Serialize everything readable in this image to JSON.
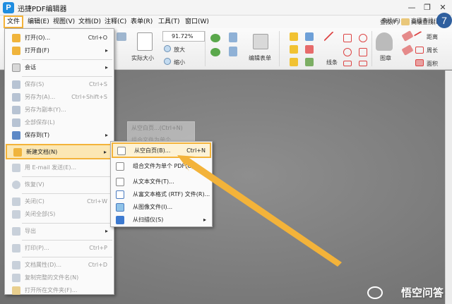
{
  "app": {
    "logo": "P",
    "title": "迅捷PDF编辑器"
  },
  "window_controls": {
    "minimize": "—",
    "restore": "❐",
    "close": "✕"
  },
  "menubar": [
    "文件",
    "编辑(E)",
    "视图(V)",
    "文档(D)",
    "注释(C)",
    "表单(R)",
    "工具(T)",
    "窗口(W)"
  ],
  "ribbon": {
    "actual_size": "实际大小",
    "zoom_value": "91.72%",
    "zoom_in": "放大",
    "zoom_out": "缩小",
    "edit_form": "编辑表单",
    "lines": "线条",
    "stamp": "图章",
    "find": "查找(F)",
    "advanced_find": "高级查找(H",
    "distance": "距离",
    "perimeter": "周长",
    "area": "面积"
  },
  "badge": "7",
  "file_menu": {
    "items": [
      {
        "label": "打开(O)...",
        "shortcut": "Ctrl+O",
        "disabled": false,
        "icon": "folder-icon"
      },
      {
        "label": "打开自(F)",
        "arrow": "▸",
        "disabled": false,
        "icon": "folder-icon"
      },
      {
        "label": "会话",
        "arrow": "▸",
        "disabled": false,
        "icon": "session-icon"
      },
      {
        "label": "保存(S)",
        "shortcut": "Ctrl+S",
        "disabled": true,
        "icon": "save-icon"
      },
      {
        "label": "另存为(A)...",
        "shortcut": "Ctrl+Shift+S",
        "disabled": true,
        "icon": "save-as-icon"
      },
      {
        "label": "另存为副本(Y)...",
        "disabled": true,
        "icon": "save-copy-icon"
      },
      {
        "label": "全部保存(L)",
        "disabled": true,
        "icon": "save-all-icon"
      },
      {
        "label": "保存到(T)",
        "arrow": "▸",
        "disabled": false,
        "icon": "save-to-icon"
      },
      {
        "label": "新建文档(N)",
        "arrow": "▸",
        "disabled": false,
        "icon": "new-document-icon"
      },
      {
        "label": "用 E-mail 发送(E)...",
        "disabled": true,
        "icon": "email-icon"
      },
      {
        "label": "恢复(V)",
        "disabled": true,
        "icon": "restore-icon"
      },
      {
        "label": "关闭(C)",
        "shortcut": "Ctrl+W",
        "disabled": true,
        "icon": "close-doc-icon"
      },
      {
        "label": "关闭全部(S)",
        "disabled": true,
        "icon": "close-all-icon"
      },
      {
        "label": "导出",
        "arrow": "▸",
        "disabled": true,
        "icon": "export-icon"
      },
      {
        "label": "打印(P)...",
        "shortcut": "Ctrl+P",
        "disabled": true,
        "icon": "print-icon"
      },
      {
        "label": "文档属性(D)...",
        "shortcut": "Ctrl+D",
        "disabled": true,
        "icon": "properties-icon"
      },
      {
        "label": "复制完整的文件名(N)",
        "disabled": true,
        "icon": "copy-filename-icon"
      },
      {
        "label": "打开所在文件夹(F)...",
        "disabled": true,
        "icon": "open-folder-icon"
      }
    ]
  },
  "new_doc_submenu": {
    "items": [
      {
        "label": "从空白页(B)...",
        "shortcut": "Ctrl+N",
        "icon": "blank-page-icon"
      },
      {
        "label": "组合文件为单个 PDF(C)...",
        "icon": "combine-files-icon"
      },
      {
        "label": "从文本文件(T)...",
        "icon": "text-file-icon"
      },
      {
        "label": "从富文本格式 (RTF) 文件(R)...",
        "icon": "rtf-file-icon"
      },
      {
        "label": "从图像文件(I)...",
        "icon": "image-file-icon"
      },
      {
        "label": "从扫描仪(S)",
        "arrow": "▸",
        "icon": "scanner-icon"
      }
    ]
  },
  "ghost": {
    "line1": "从空白页...(Ctrl+N)",
    "line2": "组合文件为单个..."
  },
  "watermark": "悟空问答",
  "colors": {
    "highlight_border": "#f3b33a",
    "arrow": "#f3b33a",
    "doc_bg": "#7d7d7d"
  }
}
